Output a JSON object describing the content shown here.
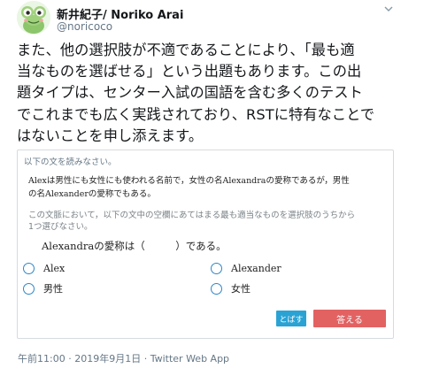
{
  "author": {
    "display_name": "新井紀子/ Noriko Arai",
    "handle": "@noricoco",
    "avatar_icon": "frog-avatar-icon"
  },
  "tweet": {
    "text_lines": [
      "また、他の選択肢が不適であることにより、「最も適",
      "当なものを選ばせる」という出題もあります。この出",
      "題タイプは、センター入試の国語を含む多くのテスト",
      "でこれまでも広く実践されており、RSTに特有なことで",
      "はないことを申し添えます。"
    ]
  },
  "quiz": {
    "instruction": "以下の文を読みなさい。",
    "passage": "Alexは男性にも女性にも使われる名前で，女性の名Alexandraの愛称であるが，男性\nの名Alexanderの愛称でもある。",
    "directive": "この文脈において，以下の文中の空欄にあてはまる最も適当なものを選択肢のうちから\n1つ選びなさい。",
    "question": "Alexandraの愛称は（　　　）である。",
    "options": [
      {
        "label": "Alex"
      },
      {
        "label": "Alexander"
      },
      {
        "label": "男性"
      },
      {
        "label": "女性"
      }
    ],
    "skip_label": "とばす",
    "answer_label": "答える",
    "accent_colors": {
      "radio": "#2f86c8",
      "skip": "#2aa3d4",
      "answer": "#e26262"
    }
  },
  "footer": {
    "time": "午前11:00",
    "date": "2019年9月1日",
    "separator": "·",
    "via": "Twitter Web App"
  }
}
